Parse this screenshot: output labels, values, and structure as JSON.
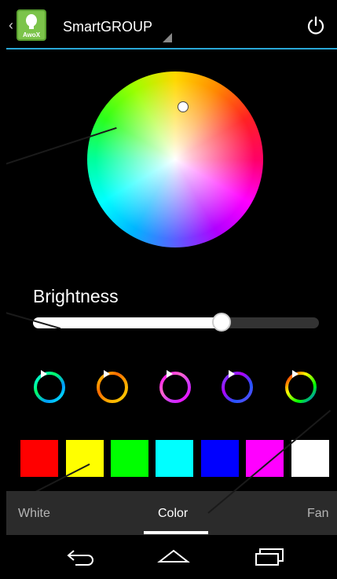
{
  "header": {
    "logo_text": "AwoX",
    "group_name": "SmartGROUP"
  },
  "colors": {
    "accent": "#29a8d8",
    "swatches": [
      "#ff0000",
      "#ffff00",
      "#00ff00",
      "#00ffff",
      "#0000ff",
      "#ff00ff",
      "#ffffff"
    ]
  },
  "brightness": {
    "label": "Brightness",
    "level_fraction": 0.66
  },
  "modes": [
    "mode-cyan-cycle",
    "mode-orange-cycle",
    "mode-pink-cycle",
    "mode-purple-cycle",
    "mode-rainbow-cycle"
  ],
  "tabs": {
    "items": [
      "White",
      "Color",
      "Fan"
    ],
    "selected": "Color"
  },
  "navbar": {
    "icons": [
      "back-icon",
      "home-icon",
      "recent-apps-icon"
    ]
  }
}
